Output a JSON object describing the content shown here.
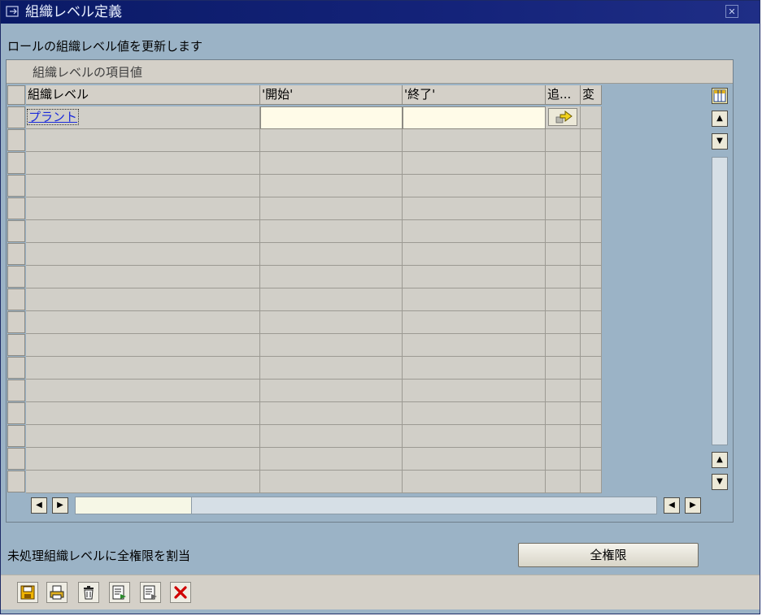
{
  "window": {
    "title": "組織レベル定義"
  },
  "subtitle": "ロールの組織レベル値を更新します",
  "panel": {
    "header": "組織レベルの項目値"
  },
  "table": {
    "columns": [
      "組織レベル",
      "'開始'",
      "'終了'",
      "追...",
      "変"
    ],
    "rows": [
      {
        "org_level": "プラント",
        "from": "",
        "to": ""
      }
    ],
    "empty_rows": 16
  },
  "footer": {
    "label": "未処理組織レベルに全権限を割当",
    "button": "全権限"
  },
  "toolbar": {
    "icons": [
      "save-icon",
      "print-icon",
      "delete-icon",
      "export-icon",
      "export-alt-icon",
      "cancel-icon"
    ]
  },
  "colors": {
    "window_bg": "#9bb3c6",
    "title_bg": "#0a1a66",
    "grid_bg": "#d1cfc8",
    "input_bg": "#fffbe8",
    "link": "#1a2adb",
    "cancel_red": "#d00000"
  }
}
